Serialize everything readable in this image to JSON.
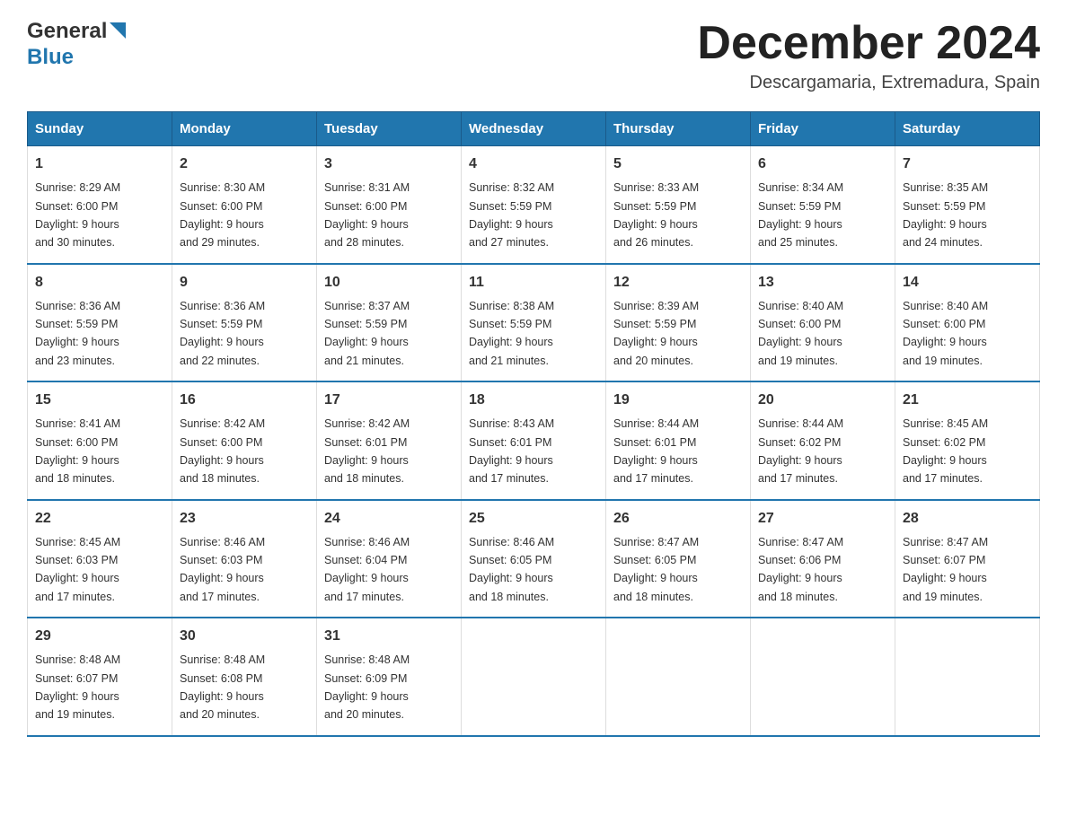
{
  "header": {
    "logo_text": "General",
    "logo_blue": "Blue",
    "month_title": "December 2024",
    "subtitle": "Descargamaria, Extremadura, Spain"
  },
  "days_of_week": [
    "Sunday",
    "Monday",
    "Tuesday",
    "Wednesday",
    "Thursday",
    "Friday",
    "Saturday"
  ],
  "weeks": [
    [
      {
        "num": "1",
        "sunrise": "8:29 AM",
        "sunset": "6:00 PM",
        "daylight": "9 hours and 30 minutes."
      },
      {
        "num": "2",
        "sunrise": "8:30 AM",
        "sunset": "6:00 PM",
        "daylight": "9 hours and 29 minutes."
      },
      {
        "num": "3",
        "sunrise": "8:31 AM",
        "sunset": "6:00 PM",
        "daylight": "9 hours and 28 minutes."
      },
      {
        "num": "4",
        "sunrise": "8:32 AM",
        "sunset": "5:59 PM",
        "daylight": "9 hours and 27 minutes."
      },
      {
        "num": "5",
        "sunrise": "8:33 AM",
        "sunset": "5:59 PM",
        "daylight": "9 hours and 26 minutes."
      },
      {
        "num": "6",
        "sunrise": "8:34 AM",
        "sunset": "5:59 PM",
        "daylight": "9 hours and 25 minutes."
      },
      {
        "num": "7",
        "sunrise": "8:35 AM",
        "sunset": "5:59 PM",
        "daylight": "9 hours and 24 minutes."
      }
    ],
    [
      {
        "num": "8",
        "sunrise": "8:36 AM",
        "sunset": "5:59 PM",
        "daylight": "9 hours and 23 minutes."
      },
      {
        "num": "9",
        "sunrise": "8:36 AM",
        "sunset": "5:59 PM",
        "daylight": "9 hours and 22 minutes."
      },
      {
        "num": "10",
        "sunrise": "8:37 AM",
        "sunset": "5:59 PM",
        "daylight": "9 hours and 21 minutes."
      },
      {
        "num": "11",
        "sunrise": "8:38 AM",
        "sunset": "5:59 PM",
        "daylight": "9 hours and 21 minutes."
      },
      {
        "num": "12",
        "sunrise": "8:39 AM",
        "sunset": "5:59 PM",
        "daylight": "9 hours and 20 minutes."
      },
      {
        "num": "13",
        "sunrise": "8:40 AM",
        "sunset": "6:00 PM",
        "daylight": "9 hours and 19 minutes."
      },
      {
        "num": "14",
        "sunrise": "8:40 AM",
        "sunset": "6:00 PM",
        "daylight": "9 hours and 19 minutes."
      }
    ],
    [
      {
        "num": "15",
        "sunrise": "8:41 AM",
        "sunset": "6:00 PM",
        "daylight": "9 hours and 18 minutes."
      },
      {
        "num": "16",
        "sunrise": "8:42 AM",
        "sunset": "6:00 PM",
        "daylight": "9 hours and 18 minutes."
      },
      {
        "num": "17",
        "sunrise": "8:42 AM",
        "sunset": "6:01 PM",
        "daylight": "9 hours and 18 minutes."
      },
      {
        "num": "18",
        "sunrise": "8:43 AM",
        "sunset": "6:01 PM",
        "daylight": "9 hours and 17 minutes."
      },
      {
        "num": "19",
        "sunrise": "8:44 AM",
        "sunset": "6:01 PM",
        "daylight": "9 hours and 17 minutes."
      },
      {
        "num": "20",
        "sunrise": "8:44 AM",
        "sunset": "6:02 PM",
        "daylight": "9 hours and 17 minutes."
      },
      {
        "num": "21",
        "sunrise": "8:45 AM",
        "sunset": "6:02 PM",
        "daylight": "9 hours and 17 minutes."
      }
    ],
    [
      {
        "num": "22",
        "sunrise": "8:45 AM",
        "sunset": "6:03 PM",
        "daylight": "9 hours and 17 minutes."
      },
      {
        "num": "23",
        "sunrise": "8:46 AM",
        "sunset": "6:03 PM",
        "daylight": "9 hours and 17 minutes."
      },
      {
        "num": "24",
        "sunrise": "8:46 AM",
        "sunset": "6:04 PM",
        "daylight": "9 hours and 17 minutes."
      },
      {
        "num": "25",
        "sunrise": "8:46 AM",
        "sunset": "6:05 PM",
        "daylight": "9 hours and 18 minutes."
      },
      {
        "num": "26",
        "sunrise": "8:47 AM",
        "sunset": "6:05 PM",
        "daylight": "9 hours and 18 minutes."
      },
      {
        "num": "27",
        "sunrise": "8:47 AM",
        "sunset": "6:06 PM",
        "daylight": "9 hours and 18 minutes."
      },
      {
        "num": "28",
        "sunrise": "8:47 AM",
        "sunset": "6:07 PM",
        "daylight": "9 hours and 19 minutes."
      }
    ],
    [
      {
        "num": "29",
        "sunrise": "8:48 AM",
        "sunset": "6:07 PM",
        "daylight": "9 hours and 19 minutes."
      },
      {
        "num": "30",
        "sunrise": "8:48 AM",
        "sunset": "6:08 PM",
        "daylight": "9 hours and 20 minutes."
      },
      {
        "num": "31",
        "sunrise": "8:48 AM",
        "sunset": "6:09 PM",
        "daylight": "9 hours and 20 minutes."
      },
      null,
      null,
      null,
      null
    ]
  ],
  "labels": {
    "sunrise": "Sunrise:",
    "sunset": "Sunset:",
    "daylight": "Daylight:"
  }
}
